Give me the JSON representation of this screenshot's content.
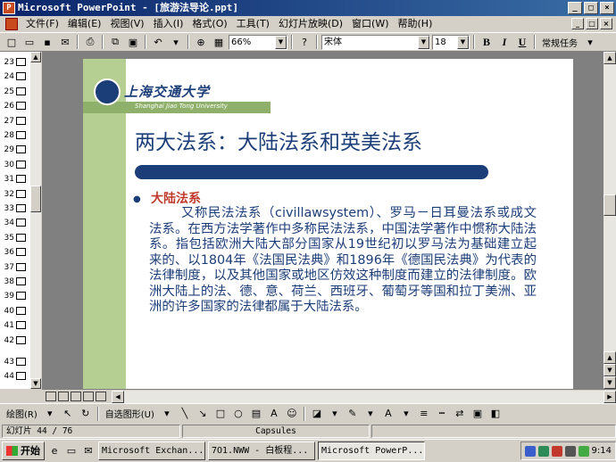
{
  "window": {
    "title": "Microsoft PowerPoint - [旅游法导论.ppt]",
    "minimize": "_",
    "maximize": "□",
    "close": "×"
  },
  "menu": [
    "文件(F)",
    "编辑(E)",
    "视图(V)",
    "插入(I)",
    "格式(O)",
    "工具(T)",
    "幻灯片放映(D)",
    "窗口(W)",
    "帮助(H)"
  ],
  "toolbar": {
    "zoom": "66%",
    "font": "宋体",
    "size": "18",
    "bold": "B",
    "italic": "I",
    "underline": "U",
    "tasks": "常规任务"
  },
  "sidebar": {
    "slide_numbers": [
      "23",
      "24",
      "25",
      "26",
      "27",
      "28",
      "29",
      "30",
      "31",
      "32",
      "33",
      "34",
      "35",
      "36",
      "37",
      "38",
      "39",
      "40",
      "41",
      "42",
      "43",
      "44"
    ]
  },
  "slide": {
    "logo_cn": "上海交通大学",
    "logo_en": "Shanghai Jiao Tong University",
    "title": "两大法系：大陆法系和英美法系",
    "bullet_head": "大陆法系",
    "body": "又称民法法系（civillawsystem）、罗马－日耳曼法系或成文法系。在西方法学著作中多称民法法系，中国法学著作中惯称大陆法系。指包括欧洲大陆大部分国家从19世纪初以罗马法为基础建立起来的、以1804年《法国民法典》和1896年《德国民法典》为代表的法律制度，以及其他国家或地区仿效这种制度而建立的法律制度。欧洲大陆上的法、德、意、荷兰、西班牙、葡萄牙等国和拉丁美洲、亚洲的许多国家的法律都属于大陆法系。"
  },
  "drawbar": {
    "draw": "绘图(R)",
    "autoshapes": "自选图形(U)"
  },
  "status": {
    "slide": "幻灯片 44 / 76",
    "template": "Capsules"
  },
  "taskbar": {
    "start": "开始",
    "tasks": [
      "Microsoft Exchan...",
      "7O1.NWW - 白板程...",
      "Microsoft PowerP..."
    ],
    "time": "9:14"
  },
  "colors": {
    "title_blue": "#1c3e78",
    "accent_green": "#b5cf93",
    "heading_red": "#c0392b"
  }
}
